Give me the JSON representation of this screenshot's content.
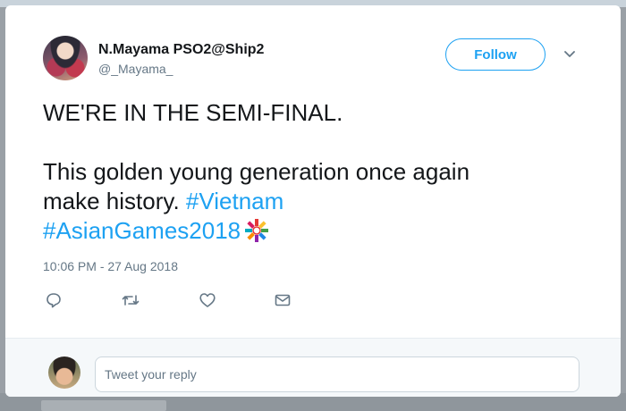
{
  "tweet": {
    "display_name": "N.Mayama PSO2@Ship2",
    "handle": "@_Mayama_",
    "follow_label": "Follow",
    "text": {
      "line1": "WE'RE IN THE SEMI-FINAL.",
      "line2": "This golden young generation once again",
      "line3": "make history. ",
      "hashtag1": "#Vietnam",
      "hashtag2": "#AsianGames2018"
    },
    "timestamp": "10:06 PM - 27 Aug 2018"
  },
  "icons": {
    "caret": "chevron-down-icon",
    "emoji": "asian-games-mascot-emoji",
    "reply": "reply-icon",
    "retweet": "retweet-icon",
    "like": "heart-icon",
    "dm": "envelope-icon"
  },
  "reply_box": {
    "placeholder": "Tweet your reply"
  },
  "colors": {
    "accent": "#1da1f2",
    "text": "#14171a",
    "muted": "#657786"
  }
}
